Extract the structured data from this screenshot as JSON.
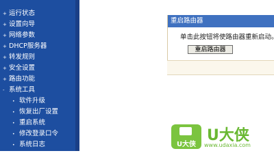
{
  "sidebar": {
    "items": [
      {
        "label": "运行状态",
        "bullet": "+"
      },
      {
        "label": "设置向导",
        "bullet": "+"
      },
      {
        "label": "网络参数",
        "bullet": "+"
      },
      {
        "label": "DHCP服务器",
        "bullet": "+"
      },
      {
        "label": "转发规则",
        "bullet": "+"
      },
      {
        "label": "安全设置",
        "bullet": "+"
      },
      {
        "label": "路由功能",
        "bullet": "+"
      },
      {
        "label": "系统工具",
        "bullet": "-"
      }
    ],
    "subitems": [
      {
        "label": "软件升级",
        "bullet": "•"
      },
      {
        "label": "恢复出厂设置",
        "bullet": "•"
      },
      {
        "label": "重启系统",
        "bullet": "•"
      },
      {
        "label": "修改登录口令",
        "bullet": "•"
      },
      {
        "label": "系统日志",
        "bullet": "•"
      }
    ]
  },
  "panel": {
    "title": "重启路由器",
    "description": "单击此按钮将使路由器重新启动。",
    "button_label": "重启路由器"
  },
  "watermark": {
    "badge_text": "U大侠",
    "title": "U大侠",
    "url": "www.udaxia.com"
  },
  "colors": {
    "sidebar_bg": "#1d4ea0",
    "panel_title_bg": "#3f71c0",
    "logo_green": "#69b832"
  }
}
